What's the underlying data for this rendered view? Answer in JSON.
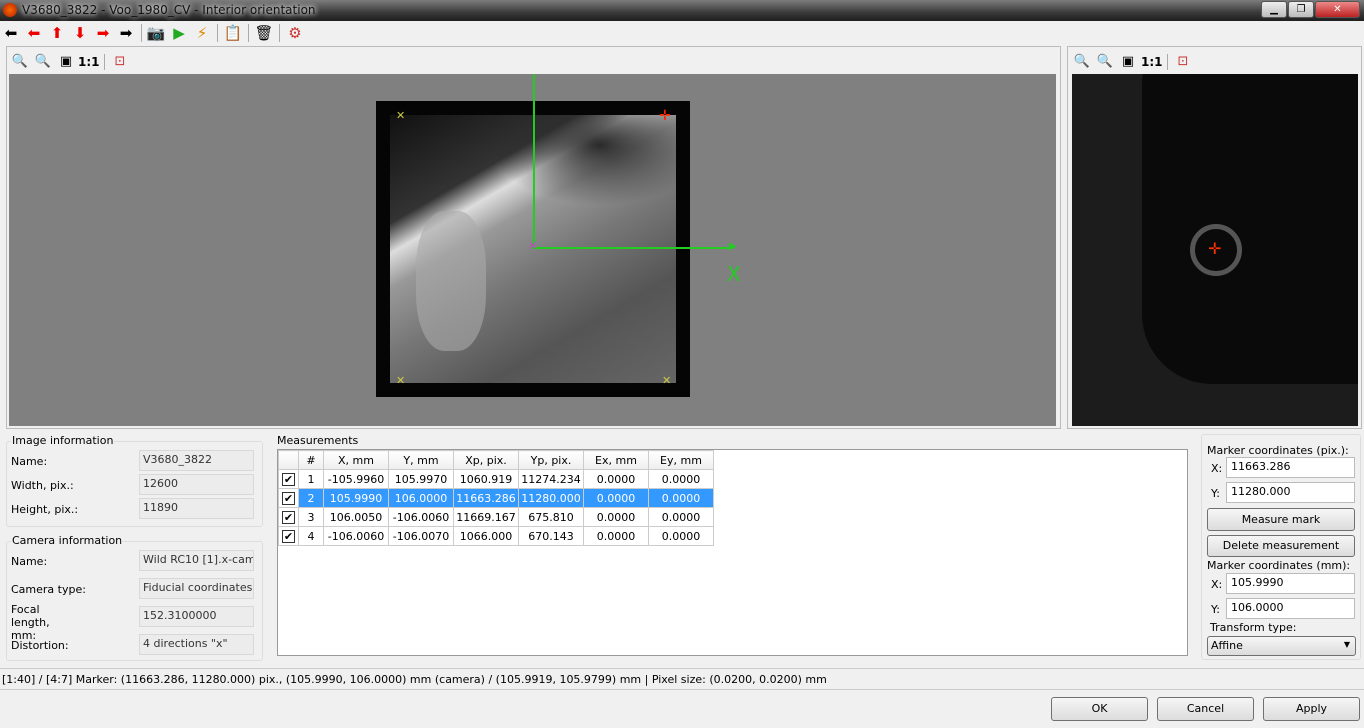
{
  "window": {
    "title": "V3680_3822 - Voo_1980_CV - Interior orientation",
    "controls": [
      "minimize",
      "maximize",
      "close"
    ]
  },
  "toolbar": {
    "icons": [
      "arrow-left-black",
      "arrow-left-red",
      "arrow-up-red",
      "arrow-down-red",
      "arrow-right-red",
      "arrow-right-black",
      "camera",
      "image-next",
      "image-auto",
      "copy-list",
      "trash",
      "add-settings"
    ]
  },
  "viewer": {
    "zoom_in": "zoom-in",
    "zoom_out": "zoom-out",
    "zoom_fit": "zoom-fit",
    "one_to_one": "1:1",
    "axis_label": "X",
    "fit_marker": "center-marker"
  },
  "detail_viewer": {
    "one_to_one": "1:1"
  },
  "image_info": {
    "title": "Image information",
    "fields": [
      {
        "label": "Name:",
        "value": "V3680_3822"
      },
      {
        "label": "Width, pix.:",
        "value": "12600"
      },
      {
        "label": "Height, pix.:",
        "value": "11890"
      }
    ]
  },
  "camera_info": {
    "title": "Camera information",
    "fields": [
      {
        "label": "Name:",
        "value": "Wild RC10 [1].x-cam"
      },
      {
        "label": "Camera type:",
        "value": "Fiducial coordinates"
      },
      {
        "label": "Focal length, mm:",
        "value": "152.3100000"
      },
      {
        "label": "Distortion:",
        "value": "4 directions \"x\""
      }
    ]
  },
  "measurements": {
    "title": "Measurements",
    "columns": [
      "#",
      "X, mm",
      "Y, mm",
      "Xp, pix.",
      "Yp, pix.",
      "Ex, mm",
      "Ey, mm"
    ],
    "rows": [
      {
        "checked": true,
        "cells": [
          "1",
          "-105.9960",
          "105.9970",
          "1060.919",
          "11274.234",
          "0.0000",
          "0.0000"
        ]
      },
      {
        "checked": true,
        "selected": true,
        "cells": [
          "2",
          "105.9990",
          "106.0000",
          "11663.286",
          "11280.000",
          "0.0000",
          "0.0000"
        ]
      },
      {
        "checked": true,
        "cells": [
          "3",
          "106.0050",
          "-106.0060",
          "11669.167",
          "675.810",
          "0.0000",
          "0.0000"
        ]
      },
      {
        "checked": true,
        "cells": [
          "4",
          "-106.0060",
          "-106.0070",
          "1066.000",
          "670.143",
          "0.0000",
          "0.0000"
        ]
      }
    ]
  },
  "marker": {
    "pix_label": "Marker coordinates (pix.):",
    "x_label": "X:",
    "y_label": "Y:",
    "pix_x": "11663.286",
    "pix_y": "11280.000",
    "measure_mark": "Measure mark",
    "delete_measurement": "Delete measurement",
    "mm_label": "Marker coordinates (mm):",
    "mm_x": "105.9990",
    "mm_y": "106.0000",
    "transform_label": "Transform type:",
    "transform_value": "Affine"
  },
  "status": "[1:40] / [4:7] Marker: (11663.286, 11280.000) pix., (105.9990, 106.0000) mm (camera) / (105.9919, 105.9799) mm | Pixel size: (0.0200, 0.0200) mm",
  "buttons": {
    "ok": "OK",
    "cancel": "Cancel",
    "apply": "Apply"
  },
  "colors": {
    "selection": "#3399ff",
    "axis": "#22cc22",
    "marker": "#ff2200"
  }
}
